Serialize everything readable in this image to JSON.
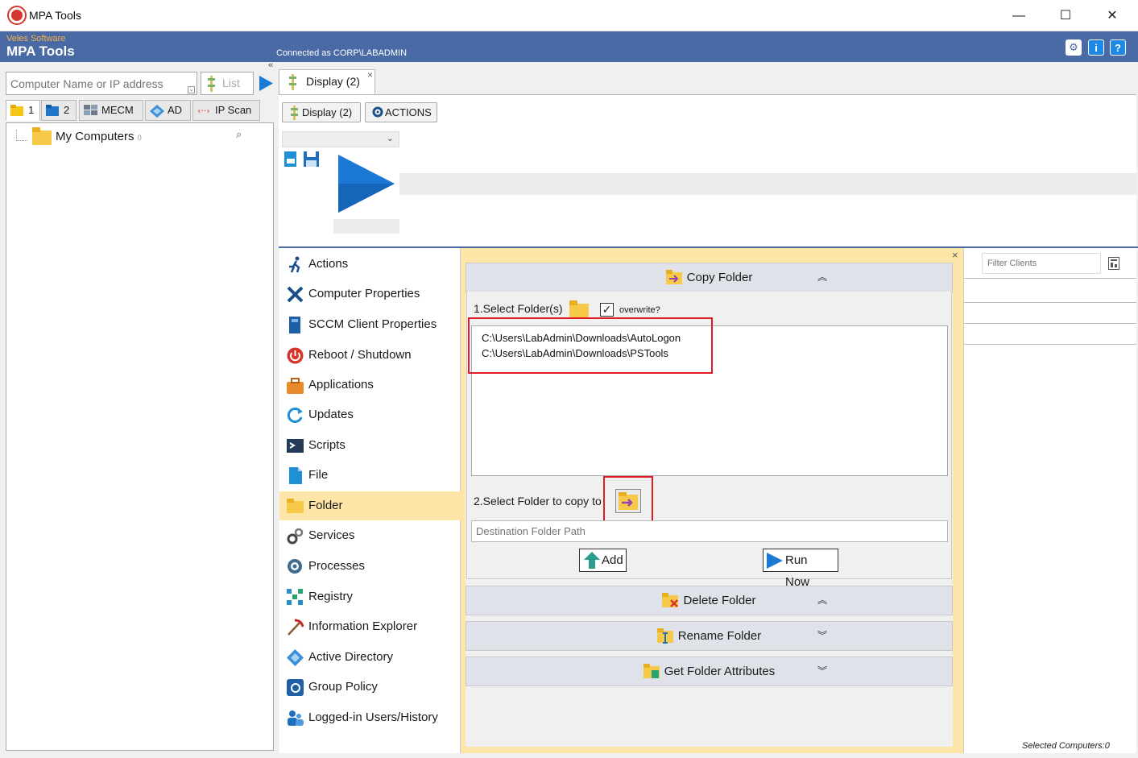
{
  "window": {
    "title": "MPA Tools",
    "minimize": "—",
    "maximize": "☐",
    "close": "✕"
  },
  "banner": {
    "company": "Veles Software",
    "product": "MPA Tools",
    "connection": "Connected as CORP\\LABADMIN",
    "buttons": [
      "settings-icon",
      "info-icon",
      "help-icon"
    ]
  },
  "left": {
    "search_placeholder": "Computer Name or IP address",
    "list_label": "List",
    "collapse": "«",
    "tabs": [
      {
        "label": "1",
        "icon": "folder-icon"
      },
      {
        "label": "2",
        "icon": "folder-blue-icon"
      },
      {
        "label": "MECM",
        "icon": "mecm-icon"
      },
      {
        "label": "AD",
        "icon": "ad-icon"
      },
      {
        "label": "IP Scan",
        "icon": "ip-scan-icon"
      }
    ],
    "tree": {
      "root_label": "My Computers",
      "root_count": "0"
    }
  },
  "main": {
    "display_tab": "Display (2)",
    "display_tab_close": "×",
    "subtabs": [
      {
        "label": "Display (2)"
      },
      {
        "label": "ACTIONS"
      }
    ],
    "close_x": "×"
  },
  "categories": [
    {
      "label": "Actions",
      "icon": "running-man-icon"
    },
    {
      "label": "Computer Properties",
      "icon": "tools-icon"
    },
    {
      "label": "SCCM Client Properties",
      "icon": "sccm-icon"
    },
    {
      "label": "Reboot / Shutdown",
      "icon": "power-icon"
    },
    {
      "label": "Applications",
      "icon": "applications-icon"
    },
    {
      "label": "Updates",
      "icon": "refresh-icon"
    },
    {
      "label": "Scripts",
      "icon": "powershell-icon"
    },
    {
      "label": "File",
      "icon": "file-icon"
    },
    {
      "label": "Folder",
      "icon": "folder-icon",
      "selected": true
    },
    {
      "label": "Services",
      "icon": "gears-icon"
    },
    {
      "label": "Processes",
      "icon": "processes-icon"
    },
    {
      "label": "Registry",
      "icon": "registry-icon"
    },
    {
      "label": "Information Explorer",
      "icon": "pickaxe-icon"
    },
    {
      "label": "Active Directory",
      "icon": "ad-icon"
    },
    {
      "label": "Group Policy",
      "icon": "group-policy-icon"
    },
    {
      "label": "Logged-in Users/History",
      "icon": "users-icon"
    }
  ],
  "copy_folder": {
    "title": "Copy Folder",
    "select_label": "1.Select Folder(s)",
    "overwrite_label": "overwrite?",
    "overwrite_checked": true,
    "folders": [
      "C:\\Users\\LabAdmin\\Downloads\\AutoLogon",
      "C:\\Users\\LabAdmin\\Downloads\\PSTools"
    ],
    "dest_label": "2.Select Folder to copy to",
    "dest_placeholder": "Destination Folder Path",
    "add_label": "Add",
    "run_label": "Run Now"
  },
  "sections": [
    {
      "title": "Delete Folder",
      "chevron": "⌃⌃"
    },
    {
      "title": "Rename Folder",
      "chevron": "⌄⌄"
    },
    {
      "title": "Get Folder Attributes",
      "chevron": "⌄⌄"
    }
  ],
  "clients": {
    "filter_placeholder": "Filter Clients",
    "status": "Selected Computers:0"
  }
}
